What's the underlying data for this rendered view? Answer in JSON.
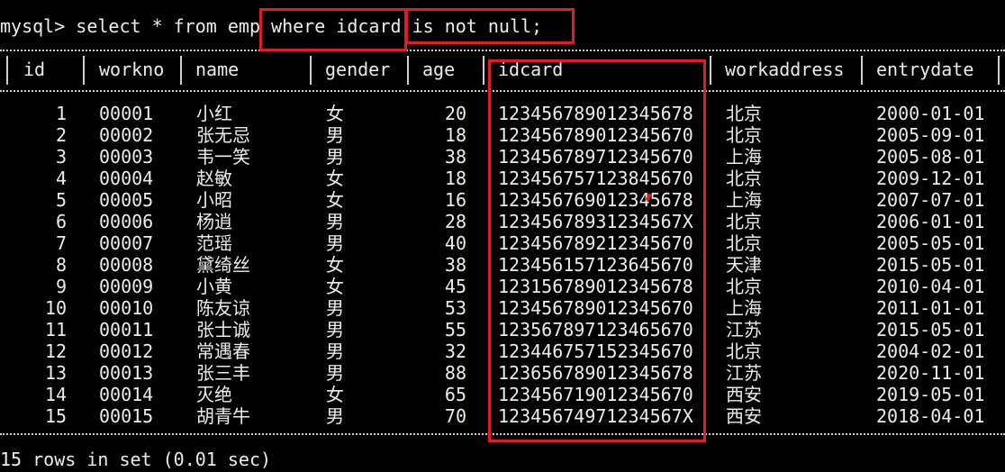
{
  "terminal": {
    "prompt": "mysql> ",
    "command_before": "select * from emp ",
    "command_where": "where idcard ",
    "command_condition": "is not null;",
    "footer": "15 rows in set (0.01 sec)"
  },
  "table": {
    "columns": [
      "id",
      "workno",
      "name",
      "gender",
      "age",
      "idcard",
      "workaddress",
      "entrydate"
    ],
    "rows": [
      [
        "1",
        "00001",
        "小红",
        "女",
        "20",
        "123456789012345678",
        "北京",
        "2000-01-01"
      ],
      [
        "2",
        "00002",
        "张无忌",
        "男",
        "18",
        "123456789012345670",
        "北京",
        "2005-09-01"
      ],
      [
        "3",
        "00003",
        "韦一笑",
        "男",
        "38",
        "123456789712345670",
        "上海",
        "2005-08-01"
      ],
      [
        "4",
        "00004",
        "赵敏",
        "女",
        "18",
        "123456757123845670",
        "北京",
        "2009-12-01"
      ],
      [
        "5",
        "00005",
        "小昭",
        "女",
        "16",
        "123456769012345678",
        "上海",
        "2007-07-01"
      ],
      [
        "6",
        "00006",
        "杨逍",
        "男",
        "28",
        "12345678931234567X",
        "北京",
        "2006-01-01"
      ],
      [
        "7",
        "00007",
        "范瑶",
        "男",
        "40",
        "123456789212345670",
        "北京",
        "2005-05-01"
      ],
      [
        "8",
        "00008",
        "黛绮丝",
        "女",
        "38",
        "123456157123645670",
        "天津",
        "2015-05-01"
      ],
      [
        "9",
        "00009",
        "小黄",
        "女",
        "45",
        "123156789012345678",
        "北京",
        "2010-04-01"
      ],
      [
        "10",
        "00010",
        "陈友谅",
        "男",
        "53",
        "123456789012345670",
        "上海",
        "2011-01-01"
      ],
      [
        "11",
        "00011",
        "张士诚",
        "男",
        "55",
        "123567897123465670",
        "江苏",
        "2015-05-01"
      ],
      [
        "12",
        "00012",
        "常遇春",
        "男",
        "32",
        "123446757152345670",
        "北京",
        "2004-02-01"
      ],
      [
        "13",
        "00013",
        "张三丰",
        "男",
        "88",
        "123656789012345678",
        "江苏",
        "2020-11-01"
      ],
      [
        "14",
        "00014",
        "灭绝",
        "女",
        "65",
        "123456719012345670",
        "西安",
        "2019-05-01"
      ],
      [
        "15",
        "00015",
        "胡青牛",
        "男",
        "70",
        "12345674971234567X",
        "西安",
        "2018-04-01"
      ]
    ]
  },
  "annotation": {
    "color": "#e31b23"
  }
}
